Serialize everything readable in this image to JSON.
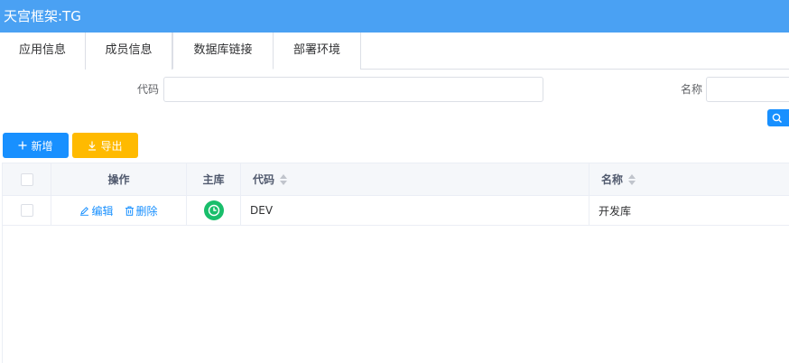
{
  "app": {
    "title": "天宫框架:TG"
  },
  "tabs": [
    {
      "label": "应用信息"
    },
    {
      "label": "成员信息"
    },
    {
      "label": "数据库链接"
    },
    {
      "label": "部署环境"
    }
  ],
  "filters": {
    "code": {
      "label": "代码",
      "value": "",
      "placeholder": ""
    },
    "name": {
      "label": "名称",
      "value": "",
      "placeholder": ""
    },
    "search_icon": "search-icon"
  },
  "toolbar": {
    "add_label": "新增",
    "add_icon": "plus-icon",
    "export_label": "导出",
    "export_icon": "download-icon"
  },
  "table": {
    "columns": [
      {
        "label": ""
      },
      {
        "label": "操作"
      },
      {
        "label": "主库"
      },
      {
        "label": "代码"
      },
      {
        "label": "名称"
      }
    ],
    "rows": [
      {
        "edit_label": "编辑",
        "delete_label": "删除",
        "is_master": true,
        "code": "DEV",
        "name": "开发库"
      }
    ]
  },
  "colors": {
    "titlebar": "#4aa1f3",
    "primary": "#1890ff",
    "warning": "#ffba00",
    "success": "#19be6b"
  }
}
